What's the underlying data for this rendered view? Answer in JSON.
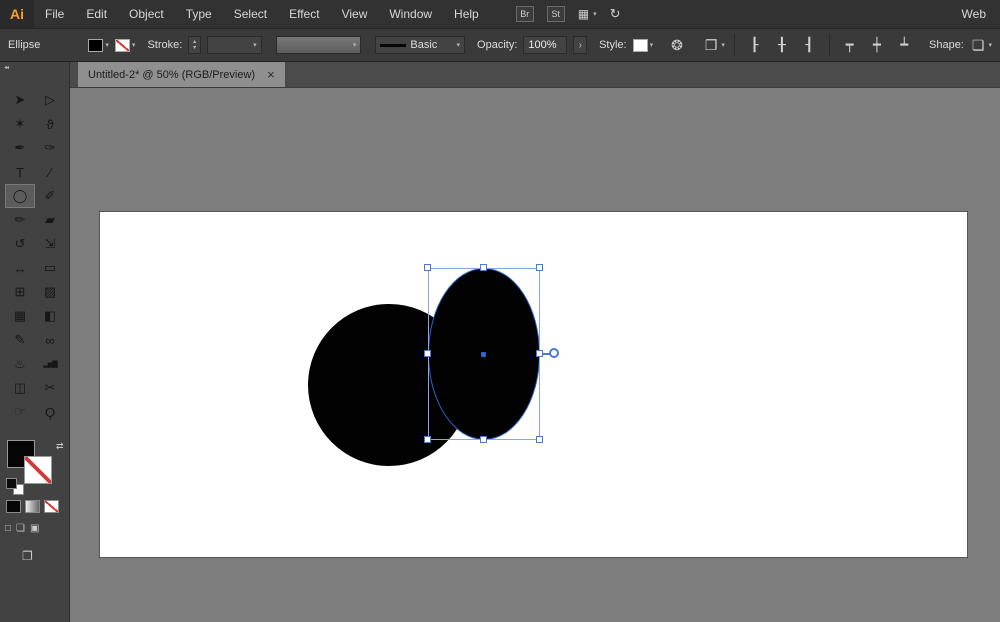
{
  "colors": {
    "menubar_bg": "#323232",
    "controlbar_bg": "#3a3a3a",
    "toolbar_bg": "#424242",
    "canvas_bg": "#7d7d7d",
    "artboard_bg": "#ffffff",
    "shape_fill": "#000000",
    "selection_blue": "#2e63cf",
    "logo_orange": "#ff9d2b",
    "none_red": "#d23b3b"
  },
  "menubar": {
    "logo": "Ai",
    "items": [
      "File",
      "Edit",
      "Object",
      "Type",
      "Select",
      "Effect",
      "View",
      "Window",
      "Help"
    ],
    "bridge_label": "Br",
    "stock_label": "St",
    "workspace_label": "Web"
  },
  "controlbar": {
    "tool_label": "Ellipse",
    "stroke_label": "Stroke:",
    "brush_name": "Basic",
    "opacity_label": "Opacity:",
    "opacity_value": "100%",
    "style_label": "Style:",
    "shape_label": "Shape:"
  },
  "tabbar": {
    "title": "Untitled-2* @ 50% (RGB/Preview)",
    "close": "×"
  },
  "toolbar": {
    "tools": [
      {
        "name": "selection-tool",
        "glyph": "➤"
      },
      {
        "name": "direct-selection-tool",
        "glyph": "▷"
      },
      {
        "name": "magic-wand-tool",
        "glyph": "✶"
      },
      {
        "name": "lasso-tool",
        "glyph": "ϑ"
      },
      {
        "name": "pen-tool",
        "glyph": "✒"
      },
      {
        "name": "curvature-tool",
        "glyph": "✑"
      },
      {
        "name": "type-tool",
        "glyph": "T"
      },
      {
        "name": "line-segment-tool",
        "glyph": "∕"
      },
      {
        "name": "ellipse-tool",
        "glyph": "◯"
      },
      {
        "name": "paintbrush-tool",
        "glyph": "✐"
      },
      {
        "name": "shaper-tool",
        "glyph": "✏"
      },
      {
        "name": "eraser-tool",
        "glyph": "▰"
      },
      {
        "name": "rotate-tool",
        "glyph": "↺"
      },
      {
        "name": "scale-tool",
        "glyph": "⇲"
      },
      {
        "name": "width-tool",
        "glyph": "↔"
      },
      {
        "name": "free-transform-tool",
        "glyph": "▭"
      },
      {
        "name": "shape-builder-tool",
        "glyph": "⊞"
      },
      {
        "name": "perspective-grid-tool",
        "glyph": "▨"
      },
      {
        "name": "mesh-tool",
        "glyph": "▦"
      },
      {
        "name": "gradient-tool",
        "glyph": "◧"
      },
      {
        "name": "eyedropper-tool",
        "glyph": "✎"
      },
      {
        "name": "blend-tool",
        "glyph": "∞"
      },
      {
        "name": "symbol-sprayer-tool",
        "glyph": "♨"
      },
      {
        "name": "column-graph-tool",
        "glyph": "▂▅▇"
      },
      {
        "name": "artboard-tool",
        "glyph": "◫"
      },
      {
        "name": "slice-tool",
        "glyph": "✂"
      },
      {
        "name": "hand-tool",
        "glyph": "☞"
      },
      {
        "name": "zoom-tool",
        "glyph": "Ϙ"
      }
    ]
  },
  "icons": {
    "caret": "▾",
    "stepper_up": "▴",
    "stepper_down": "▾",
    "workspace_grid": "▦",
    "sync": "↻",
    "recolor": "❂",
    "transform_menu": "❒",
    "align_left": "┠",
    "align_hcenter": "╂",
    "align_right": "┨",
    "align_top": "┯",
    "align_vcenter": "┿",
    "align_bottom": "┷",
    "shape_widget": "❏",
    "screen_mode": "❐",
    "swap_fill_stroke": "⇄",
    "expand": "›",
    "collapse": "◂◂",
    "draw_normal": "□",
    "draw_behind": "❏",
    "draw_inside": "▣"
  }
}
